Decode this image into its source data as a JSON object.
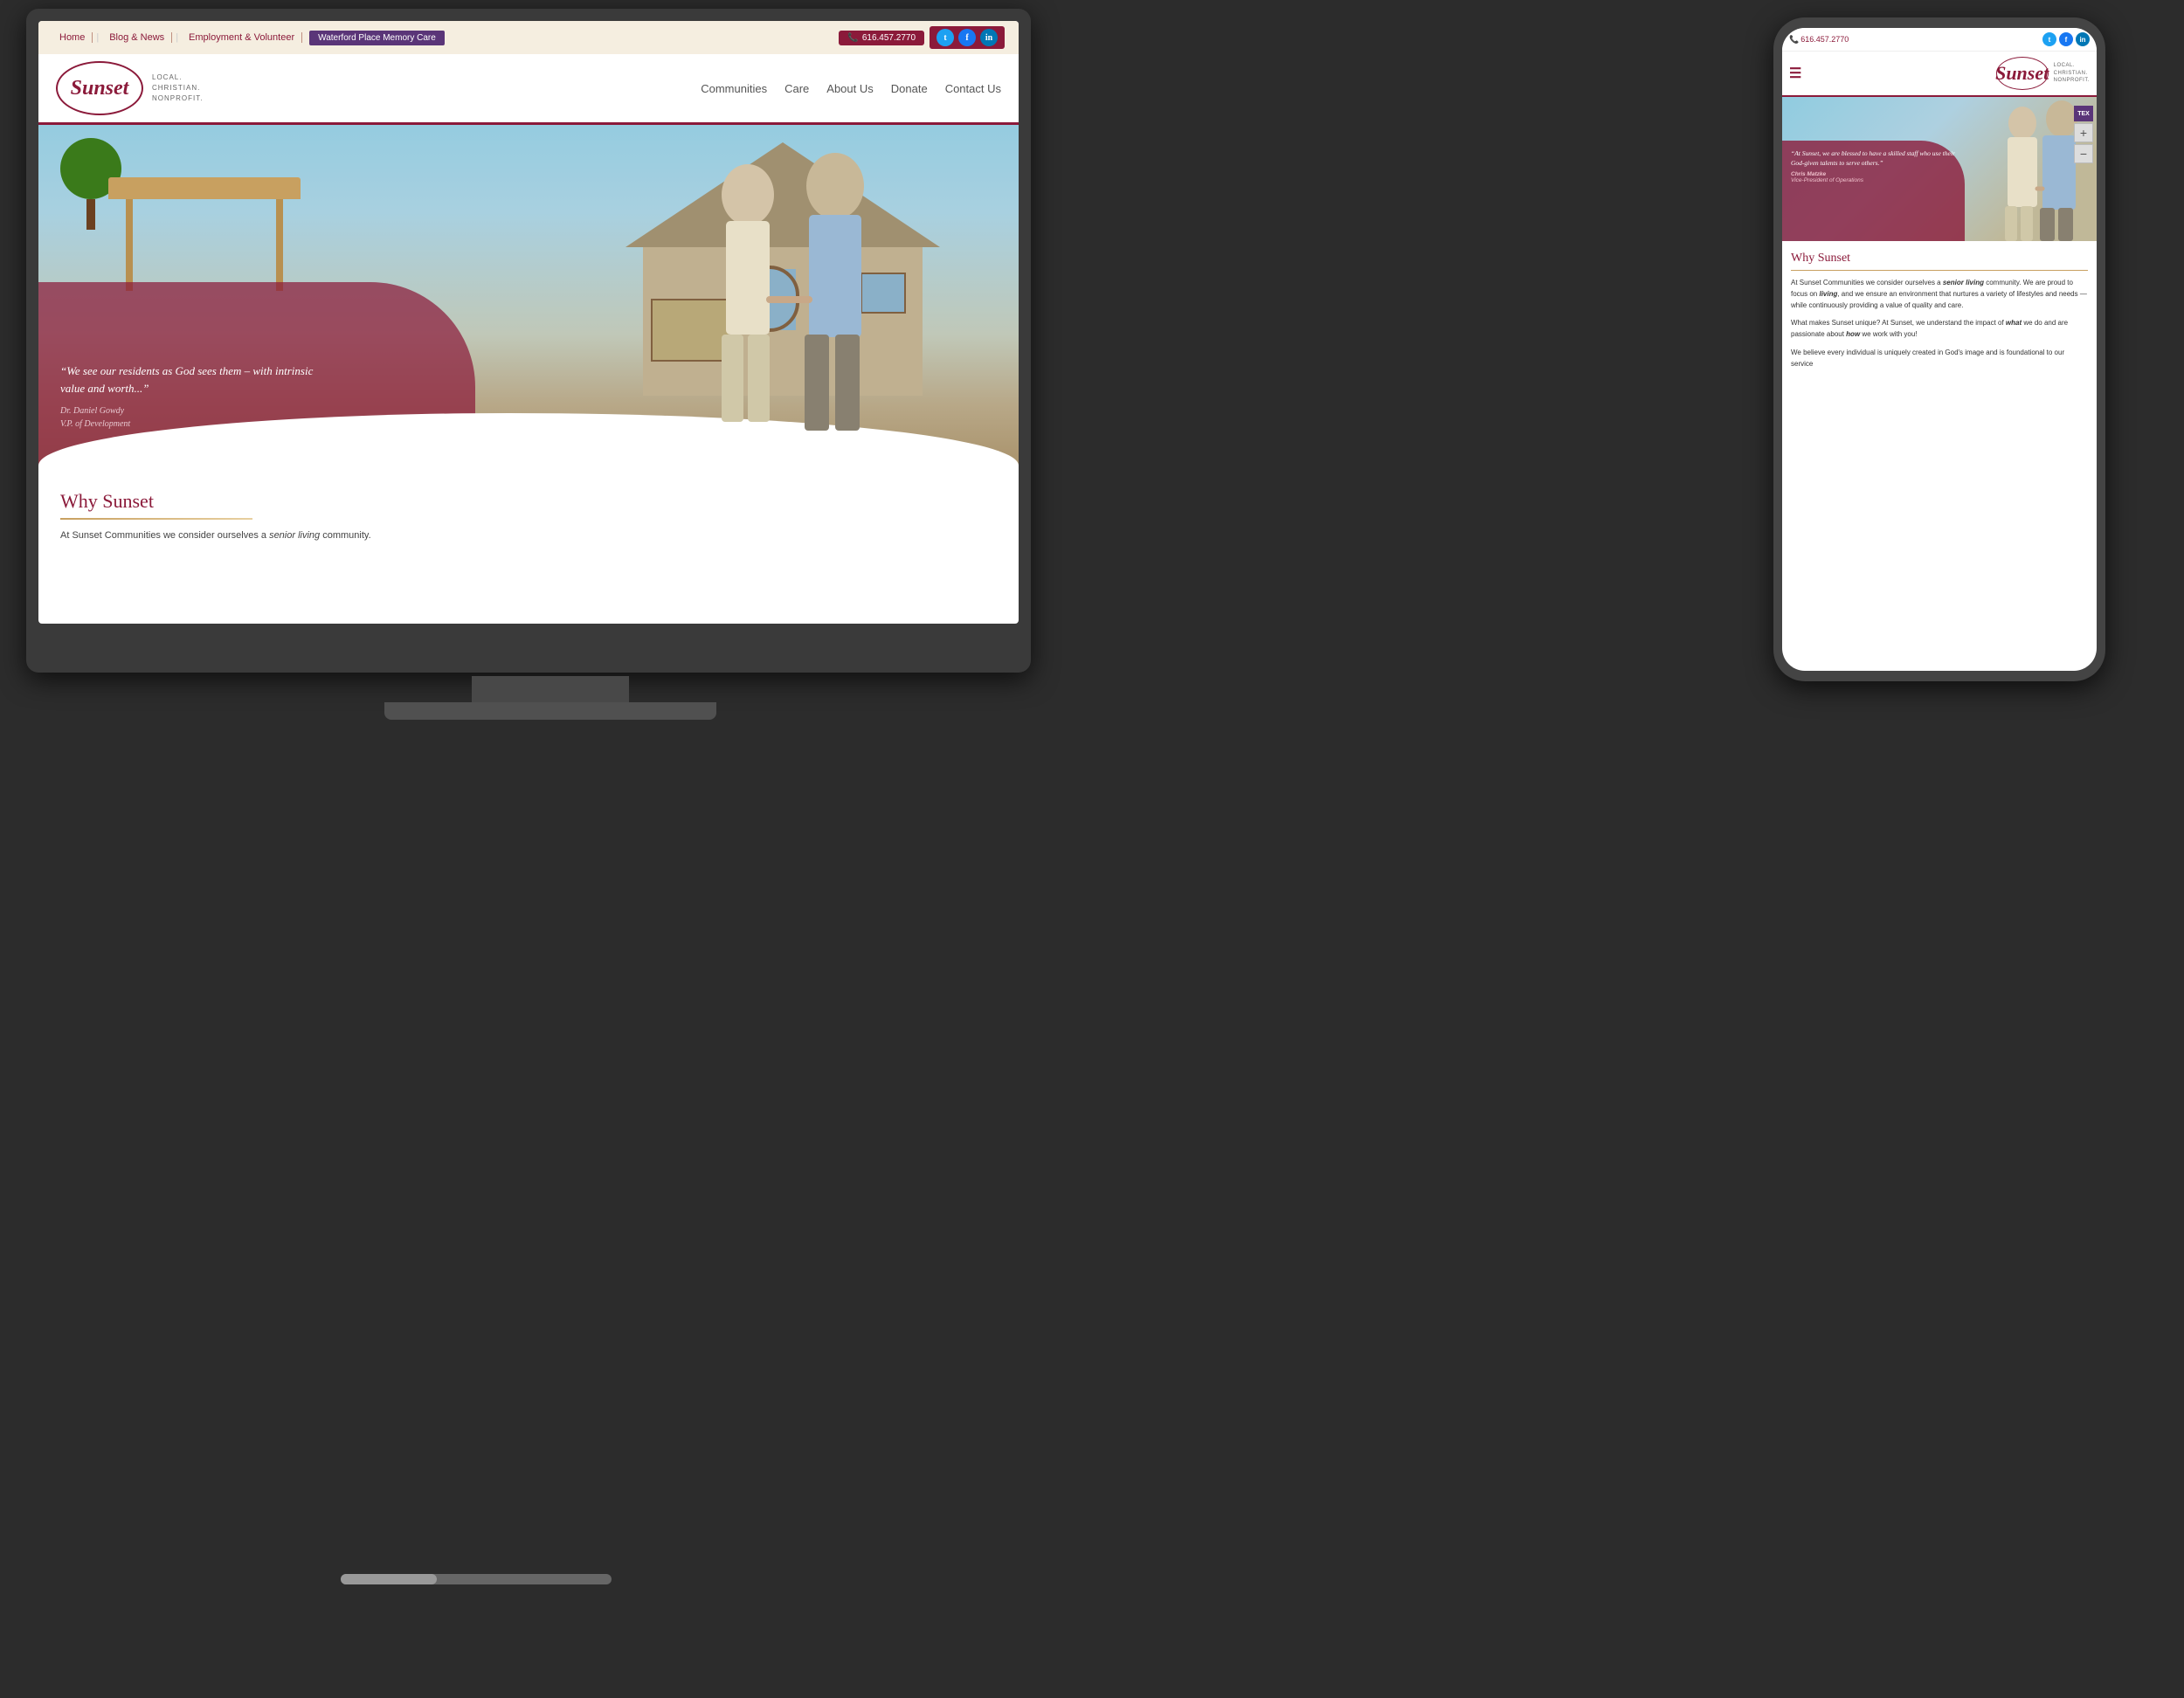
{
  "scene": {
    "bg_color": "#2c2c2c"
  },
  "desktop": {
    "bezel_color": "#3a3a3a"
  },
  "mobile": {
    "bezel_color": "#444"
  },
  "website": {
    "topbar": {
      "nav_items": [
        "Home",
        "Blog & News",
        "Employment & Volunteer"
      ],
      "memory_care_btn": "Waterford Place Memory Care",
      "phone": "616.457.2770",
      "social": [
        "T",
        "f",
        "in"
      ]
    },
    "header": {
      "logo_text": "Sunset",
      "logo_tagline_line1": "LOCAL.",
      "logo_tagline_line2": "CHRISTIAN.",
      "logo_tagline_line3": "NONPROFIT.",
      "nav_items": [
        "Communities",
        "Care",
        "About Us",
        "Donate",
        "Contact Us"
      ]
    },
    "hero": {
      "quote": "“We see our residents as God sees them – with intrinsic value and worth...”",
      "quote_author": "Dr. Daniel Gowdy",
      "quote_title": "V.P. of Development"
    },
    "why_sunset": {
      "title": "Why Sunset",
      "body_start": "At Sunset Communities we consider ourselves a ",
      "body_em": "senior living",
      "body_end": " community."
    }
  },
  "mobile_website": {
    "phone": "616.457.2770",
    "logo_text": "Sunset",
    "logo_tagline_line1": "LOCAL.",
    "logo_tagline_line2": "CHRISTIAN.",
    "logo_tagline_line3": "NONPROFIT.",
    "hero": {
      "quote": "“At Sunset, we are blessed to have a skilled staff who use their God-given talents to serve others.”",
      "quote_author": "Chris Matzke",
      "quote_title": "Vice-President of Operations"
    },
    "why_sunset": {
      "title": "Why Sunset",
      "para1_start": "At Sunset Communities we consider ourselves a ",
      "para1_em": "senior living",
      "para1_mid": " community. We are proud to focus on ",
      "para1_em2": "living",
      "para1_end": ", and we ensure an environment that nurtures a variety of lifestyles and needs — while continuously providing a value of quality and care.",
      "para2": "What makes Sunset unique? At Sunset, we understand the impact of ",
      "para2_em": "what",
      "para2_mid": " we do and are passionate about ",
      "para2_em2": "how",
      "para2_end": " we work with you!",
      "para3": "We believe every individual is uniquely created in God's image and is foundational to our service"
    },
    "zoom": {
      "plus": "+",
      "label": "TEX",
      "minus": "−"
    }
  }
}
